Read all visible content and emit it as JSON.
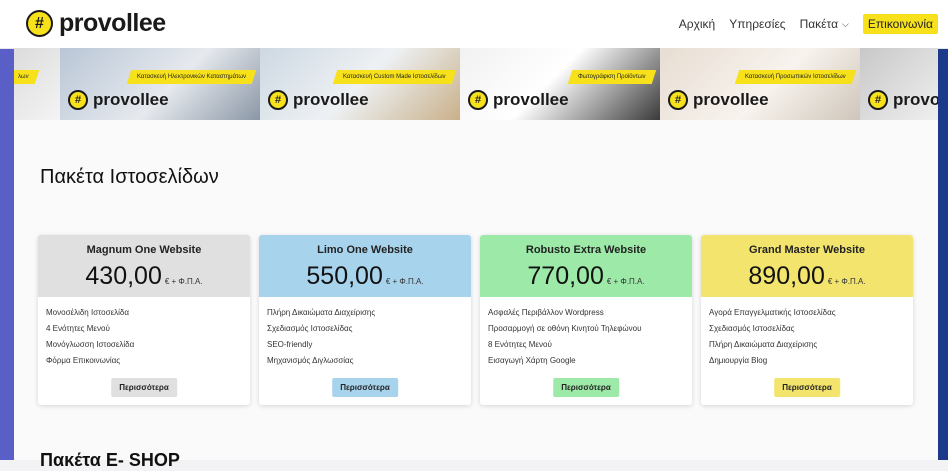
{
  "header": {
    "logo_symbol": "#",
    "logo_text": "provollee",
    "nav": {
      "home": "Αρχική",
      "services": "Υπηρεσίες",
      "packages": "Πακέτα",
      "packages_caret": "⌵",
      "contact": "Επικοινωνία"
    }
  },
  "banner": {
    "slides": [
      {
        "caption": "Κατασκευή Ηλεκτρονικών Καταστημάτων",
        "logo": "provollee"
      },
      {
        "caption": "Κατασκευή Custom Made Ιστοσελίδων",
        "logo": "provollee"
      },
      {
        "caption": "Φωτογράφιση Προϊόντων",
        "logo": "provollee"
      },
      {
        "caption": "Κατασκευή Προσωπικών Ιστοσελίδων",
        "logo": "provollee"
      },
      {
        "caption": "",
        "logo": "provo"
      }
    ],
    "partial_left_caption": "λων"
  },
  "main": {
    "section_title": "Πακέτα Ιστοσελίδων",
    "next_section_title": "Πακέτα E- SHOP"
  },
  "packages": [
    {
      "name": "Magnum One Website",
      "price": "430,00",
      "price_note": "€ + Φ.Π.Α.",
      "color": "#e0e0e0",
      "features": [
        "Μονοσέλιδη Ιστοσελίδα",
        "4 Ενότητες Μενού",
        "Μονόγλωσση Ιστοσελίδα",
        "Φόρμα Επικοινωνίας"
      ],
      "button": "Περισσότερα"
    },
    {
      "name": "Limo One Website",
      "price": "550,00",
      "price_note": "€ + Φ.Π.Α.",
      "color": "#a7d3ec",
      "features": [
        "Πλήρη Δικαιώματα Διαχείρισης",
        "Σχεδιασμός Ιστοσελίδας",
        "SEO-friendly",
        "Μηχανισμός Διγλωσσίας"
      ],
      "button": "Περισσότερα"
    },
    {
      "name": "Robusto Extra Website",
      "price": "770,00",
      "price_note": "€ + Φ.Π.Α.",
      "color": "#9deaa8",
      "features": [
        "Ασφαλές Περιβάλλον Wordpress",
        "Προσαρμογή σε οθόνη Κινητού Τηλεφώνου",
        "8 Ενότητες Μενού",
        "Εισαγωγή Χάρτη Google"
      ],
      "button": "Περισσότερα"
    },
    {
      "name": "Grand Master Website",
      "price": "890,00",
      "price_note": "€ + Φ.Π.Α.",
      "color": "#f2e46d",
      "features": [
        "Αγορά Επαγγελματικής Ιστοσελίδας",
        "Σχεδιασμός Ιστοσελίδας",
        "Πλήρη Δικαιώματα Διαχείρισης",
        "Δημιουργία Blog"
      ],
      "button": "Περισσότερα"
    }
  ],
  "colors": {
    "brand_yellow": "#f7e11a",
    "left_band": "#5a5fc8",
    "right_band": "#1d3a8a"
  }
}
